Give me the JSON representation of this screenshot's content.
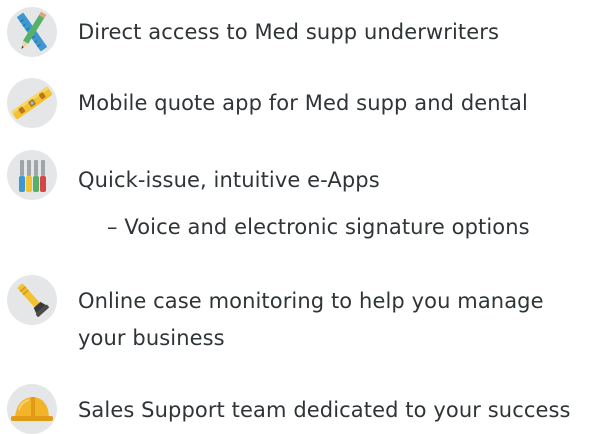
{
  "features": [
    {
      "icon": "ruler-pencil-icon",
      "lines": [
        "Direct access to Med supp underwriters"
      ]
    },
    {
      "icon": "level-tool-icon",
      "lines": [
        "Mobile quote app for Med supp and dental"
      ]
    },
    {
      "icon": "screwdrivers-icon",
      "lines": [
        "Quick-issue, intuitive e-Apps"
      ],
      "sub_lines": [
        "– Voice and electronic signature options"
      ]
    },
    {
      "icon": "flashlight-icon",
      "lines": [
        "Online case monitoring to help you manage",
        "your business"
      ]
    },
    {
      "icon": "hard-hat-icon",
      "lines": [
        "Sales Support team dedicated to your success"
      ]
    }
  ],
  "colors": {
    "text": "#2f3437",
    "icon_background": "#e4e6e8"
  }
}
